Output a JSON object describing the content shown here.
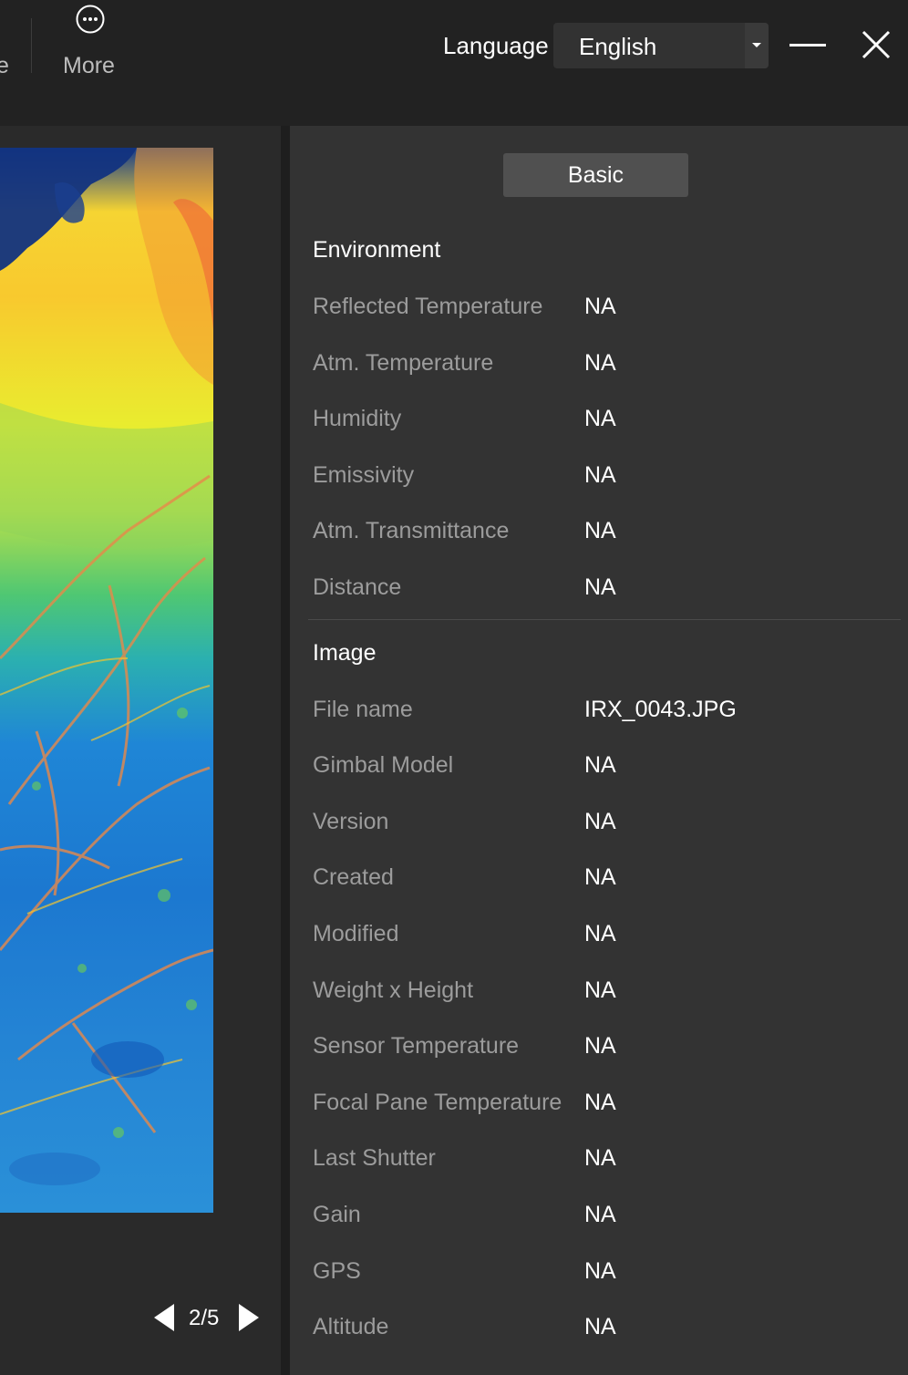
{
  "toolbar": {
    "cut_label": "e",
    "more_label": "More",
    "more_icon": "more-dots-icon",
    "language_label": "Language",
    "language_value": "English"
  },
  "viewer": {
    "pager_text": "2/5",
    "palette": [
      "#163b8c",
      "#f6d432",
      "#e9ec2f",
      "#4fc773",
      "#1f86d6",
      "#f0553a"
    ]
  },
  "panel": {
    "tab_basic": "Basic",
    "environment": {
      "title": "Environment",
      "rows": [
        {
          "label": "Reflected Temperature",
          "value": "NA"
        },
        {
          "label": "Atm. Temperature",
          "value": "NA"
        },
        {
          "label": "Humidity",
          "value": "NA"
        },
        {
          "label": "Emissivity",
          "value": "NA"
        },
        {
          "label": "Atm. Transmittance",
          "value": "NA"
        },
        {
          "label": "Distance",
          "value": "NA"
        }
      ]
    },
    "image": {
      "title": "Image",
      "rows": [
        {
          "label": "File name",
          "value": "IRX_0043.JPG"
        },
        {
          "label": "Gimbal Model",
          "value": "NA"
        },
        {
          "label": "Version",
          "value": "NA"
        },
        {
          "label": "Created",
          "value": "NA"
        },
        {
          "label": "Modified",
          "value": "NA"
        },
        {
          "label": "Weight x Height",
          "value": "NA"
        },
        {
          "label": "Sensor Temperature",
          "value": "NA"
        },
        {
          "label": "Focal Pane Temperature",
          "value": "NA"
        },
        {
          "label": "Last Shutter",
          "value": "NA"
        },
        {
          "label": "Gain",
          "value": "NA"
        },
        {
          "label": "GPS",
          "value": "NA"
        },
        {
          "label": "Altitude",
          "value": "NA"
        }
      ]
    }
  }
}
